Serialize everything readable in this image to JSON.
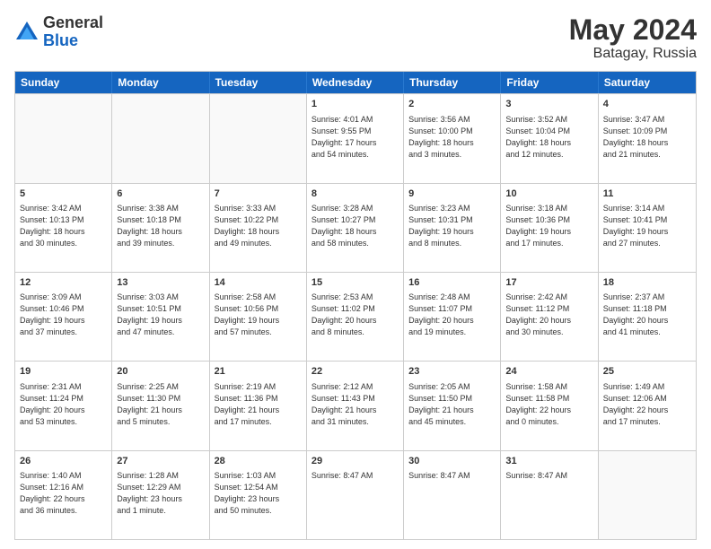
{
  "logo": {
    "general": "General",
    "blue": "Blue"
  },
  "title": "May 2024",
  "location": "Batagay, Russia",
  "days": [
    "Sunday",
    "Monday",
    "Tuesday",
    "Wednesday",
    "Thursday",
    "Friday",
    "Saturday"
  ],
  "weeks": [
    [
      {
        "day": "",
        "info": ""
      },
      {
        "day": "",
        "info": ""
      },
      {
        "day": "",
        "info": ""
      },
      {
        "day": "1",
        "info": "Sunrise: 4:01 AM\nSunset: 9:55 PM\nDaylight: 17 hours\nand 54 minutes."
      },
      {
        "day": "2",
        "info": "Sunrise: 3:56 AM\nSunset: 10:00 PM\nDaylight: 18 hours\nand 3 minutes."
      },
      {
        "day": "3",
        "info": "Sunrise: 3:52 AM\nSunset: 10:04 PM\nDaylight: 18 hours\nand 12 minutes."
      },
      {
        "day": "4",
        "info": "Sunrise: 3:47 AM\nSunset: 10:09 PM\nDaylight: 18 hours\nand 21 minutes."
      }
    ],
    [
      {
        "day": "5",
        "info": "Sunrise: 3:42 AM\nSunset: 10:13 PM\nDaylight: 18 hours\nand 30 minutes."
      },
      {
        "day": "6",
        "info": "Sunrise: 3:38 AM\nSunset: 10:18 PM\nDaylight: 18 hours\nand 39 minutes."
      },
      {
        "day": "7",
        "info": "Sunrise: 3:33 AM\nSunset: 10:22 PM\nDaylight: 18 hours\nand 49 minutes."
      },
      {
        "day": "8",
        "info": "Sunrise: 3:28 AM\nSunset: 10:27 PM\nDaylight: 18 hours\nand 58 minutes."
      },
      {
        "day": "9",
        "info": "Sunrise: 3:23 AM\nSunset: 10:31 PM\nDaylight: 19 hours\nand 8 minutes."
      },
      {
        "day": "10",
        "info": "Sunrise: 3:18 AM\nSunset: 10:36 PM\nDaylight: 19 hours\nand 17 minutes."
      },
      {
        "day": "11",
        "info": "Sunrise: 3:14 AM\nSunset: 10:41 PM\nDaylight: 19 hours\nand 27 minutes."
      }
    ],
    [
      {
        "day": "12",
        "info": "Sunrise: 3:09 AM\nSunset: 10:46 PM\nDaylight: 19 hours\nand 37 minutes."
      },
      {
        "day": "13",
        "info": "Sunrise: 3:03 AM\nSunset: 10:51 PM\nDaylight: 19 hours\nand 47 minutes."
      },
      {
        "day": "14",
        "info": "Sunrise: 2:58 AM\nSunset: 10:56 PM\nDaylight: 19 hours\nand 57 minutes."
      },
      {
        "day": "15",
        "info": "Sunrise: 2:53 AM\nSunset: 11:02 PM\nDaylight: 20 hours\nand 8 minutes."
      },
      {
        "day": "16",
        "info": "Sunrise: 2:48 AM\nSunset: 11:07 PM\nDaylight: 20 hours\nand 19 minutes."
      },
      {
        "day": "17",
        "info": "Sunrise: 2:42 AM\nSunset: 11:12 PM\nDaylight: 20 hours\nand 30 minutes."
      },
      {
        "day": "18",
        "info": "Sunrise: 2:37 AM\nSunset: 11:18 PM\nDaylight: 20 hours\nand 41 minutes."
      }
    ],
    [
      {
        "day": "19",
        "info": "Sunrise: 2:31 AM\nSunset: 11:24 PM\nDaylight: 20 hours\nand 53 minutes."
      },
      {
        "day": "20",
        "info": "Sunrise: 2:25 AM\nSunset: 11:30 PM\nDaylight: 21 hours\nand 5 minutes."
      },
      {
        "day": "21",
        "info": "Sunrise: 2:19 AM\nSunset: 11:36 PM\nDaylight: 21 hours\nand 17 minutes."
      },
      {
        "day": "22",
        "info": "Sunrise: 2:12 AM\nSunset: 11:43 PM\nDaylight: 21 hours\nand 31 minutes."
      },
      {
        "day": "23",
        "info": "Sunrise: 2:05 AM\nSunset: 11:50 PM\nDaylight: 21 hours\nand 45 minutes."
      },
      {
        "day": "24",
        "info": "Sunrise: 1:58 AM\nSunset: 11:58 PM\nDaylight: 22 hours\nand 0 minutes."
      },
      {
        "day": "25",
        "info": "Sunrise: 1:49 AM\nSunset: 12:06 AM\nDaylight: 22 hours\nand 17 minutes."
      }
    ],
    [
      {
        "day": "26",
        "info": "Sunrise: 1:40 AM\nSunset: 12:16 AM\nDaylight: 22 hours\nand 36 minutes."
      },
      {
        "day": "27",
        "info": "Sunrise: 1:28 AM\nSunset: 12:29 AM\nDaylight: 23 hours\nand 1 minute."
      },
      {
        "day": "28",
        "info": "Sunrise: 1:03 AM\nSunset: 12:54 AM\nDaylight: 23 hours\nand 50 minutes."
      },
      {
        "day": "29",
        "info": "Sunrise: 8:47 AM"
      },
      {
        "day": "30",
        "info": "Sunrise: 8:47 AM"
      },
      {
        "day": "31",
        "info": "Sunrise: 8:47 AM"
      },
      {
        "day": "",
        "info": ""
      }
    ]
  ]
}
